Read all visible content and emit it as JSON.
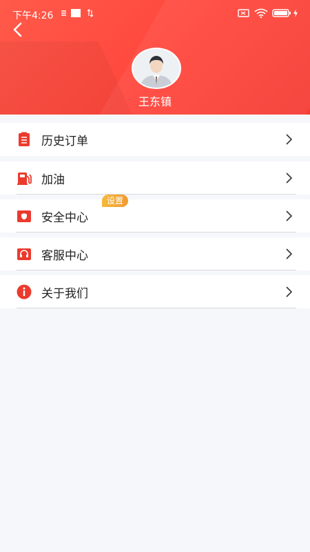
{
  "status_bar": {
    "time": "下午4:26",
    "icons": [
      "sync-icon",
      "square-icon",
      "data-arrows-icon",
      "sim-off-icon",
      "wifi-icon",
      "battery-icon",
      "charging-icon"
    ]
  },
  "header": {
    "back_icon": "chevron-left-icon",
    "username": "王东镇",
    "colors": {
      "gradient_start": "#ff5a4a",
      "gradient_end": "#f53b34"
    }
  },
  "menu": {
    "items": [
      {
        "label": "历史订单",
        "icon": "order-list-icon"
      },
      {
        "label": "加油",
        "icon": "fuel-pump-icon"
      },
      {
        "label": "安全中心",
        "icon": "shield-icon",
        "badge": "设置"
      },
      {
        "label": "客服中心",
        "icon": "headset-icon"
      },
      {
        "label": "关于我们",
        "icon": "info-icon"
      }
    ],
    "accent": "#ea3b2e"
  }
}
